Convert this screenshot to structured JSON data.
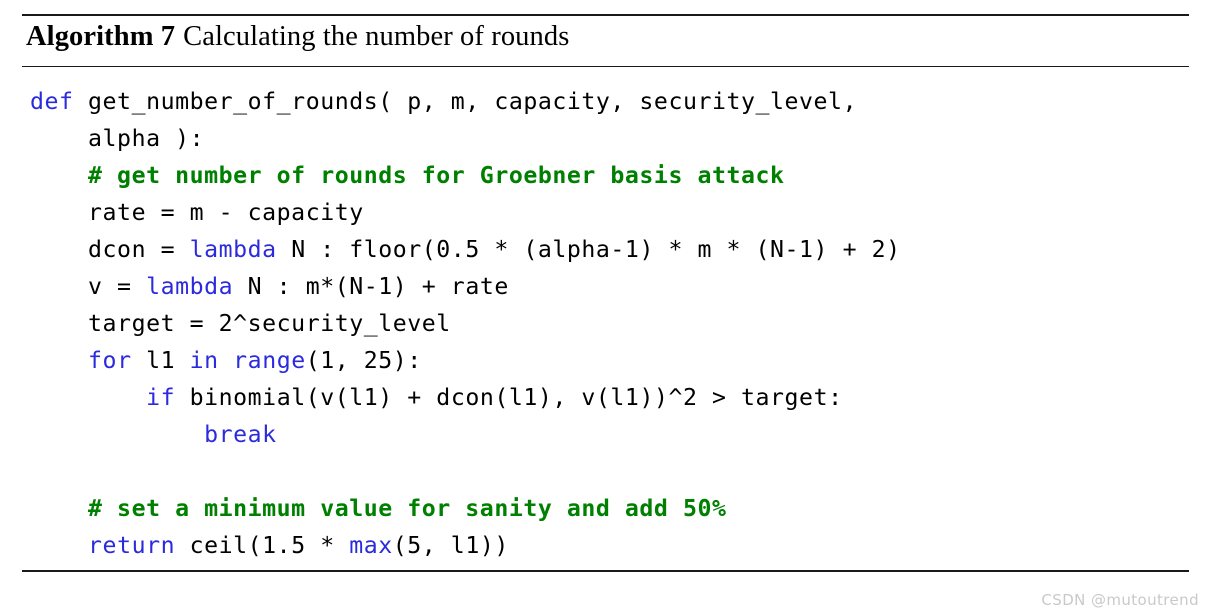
{
  "document": {
    "type": "algorithm-float",
    "background_color": "#ffffff",
    "text_color": "#000000"
  },
  "caption": {
    "label": "Algorithm 7",
    "title": "Calculating the number of rounds"
  },
  "colors": {
    "keyword": "#2b2bdd",
    "comment": "#008000",
    "plain": "#000000",
    "rule": "#1a1a1a",
    "watermark": "#c9c9c9"
  },
  "code": {
    "language": "python",
    "lines": [
      [
        {
          "t": "def",
          "c": "kw"
        },
        {
          "t": " get_number_of_rounds( p, m, capacity, security_level,",
          "c": "plain"
        }
      ],
      [
        {
          "t": "    alpha ):",
          "c": "plain"
        }
      ],
      [
        {
          "t": "    # get number of rounds for Groebner basis attack",
          "c": "com"
        }
      ],
      [
        {
          "t": "    rate = m - capacity",
          "c": "plain"
        }
      ],
      [
        {
          "t": "    dcon = ",
          "c": "plain"
        },
        {
          "t": "lambda",
          "c": "kw"
        },
        {
          "t": " N : floor(0.5 * (alpha-1) * m * (N-1) + 2)",
          "c": "plain"
        }
      ],
      [
        {
          "t": "    v = ",
          "c": "plain"
        },
        {
          "t": "lambda",
          "c": "kw"
        },
        {
          "t": " N : m*(N-1) + rate",
          "c": "plain"
        }
      ],
      [
        {
          "t": "    target = 2^security_level",
          "c": "plain"
        }
      ],
      [
        {
          "t": "    ",
          "c": "plain"
        },
        {
          "t": "for",
          "c": "kw"
        },
        {
          "t": " l1 ",
          "c": "plain"
        },
        {
          "t": "in",
          "c": "kw"
        },
        {
          "t": " ",
          "c": "plain"
        },
        {
          "t": "range",
          "c": "kw"
        },
        {
          "t": "(1, 25):",
          "c": "plain"
        }
      ],
      [
        {
          "t": "        ",
          "c": "plain"
        },
        {
          "t": "if",
          "c": "kw"
        },
        {
          "t": " binomial(v(l1) + dcon(l1), v(l1))^2 > target:",
          "c": "plain"
        }
      ],
      [
        {
          "t": "            ",
          "c": "plain"
        },
        {
          "t": "break",
          "c": "kw"
        }
      ],
      [],
      [
        {
          "t": "    # set a minimum value for sanity and add 50%",
          "c": "com"
        }
      ],
      [
        {
          "t": "    ",
          "c": "plain"
        },
        {
          "t": "return",
          "c": "kw"
        },
        {
          "t": " ceil(1.5 * ",
          "c": "plain"
        },
        {
          "t": "max",
          "c": "kw"
        },
        {
          "t": "(5, l1))",
          "c": "plain"
        }
      ]
    ]
  },
  "watermark": {
    "text": "CSDN @mutoutrend"
  }
}
